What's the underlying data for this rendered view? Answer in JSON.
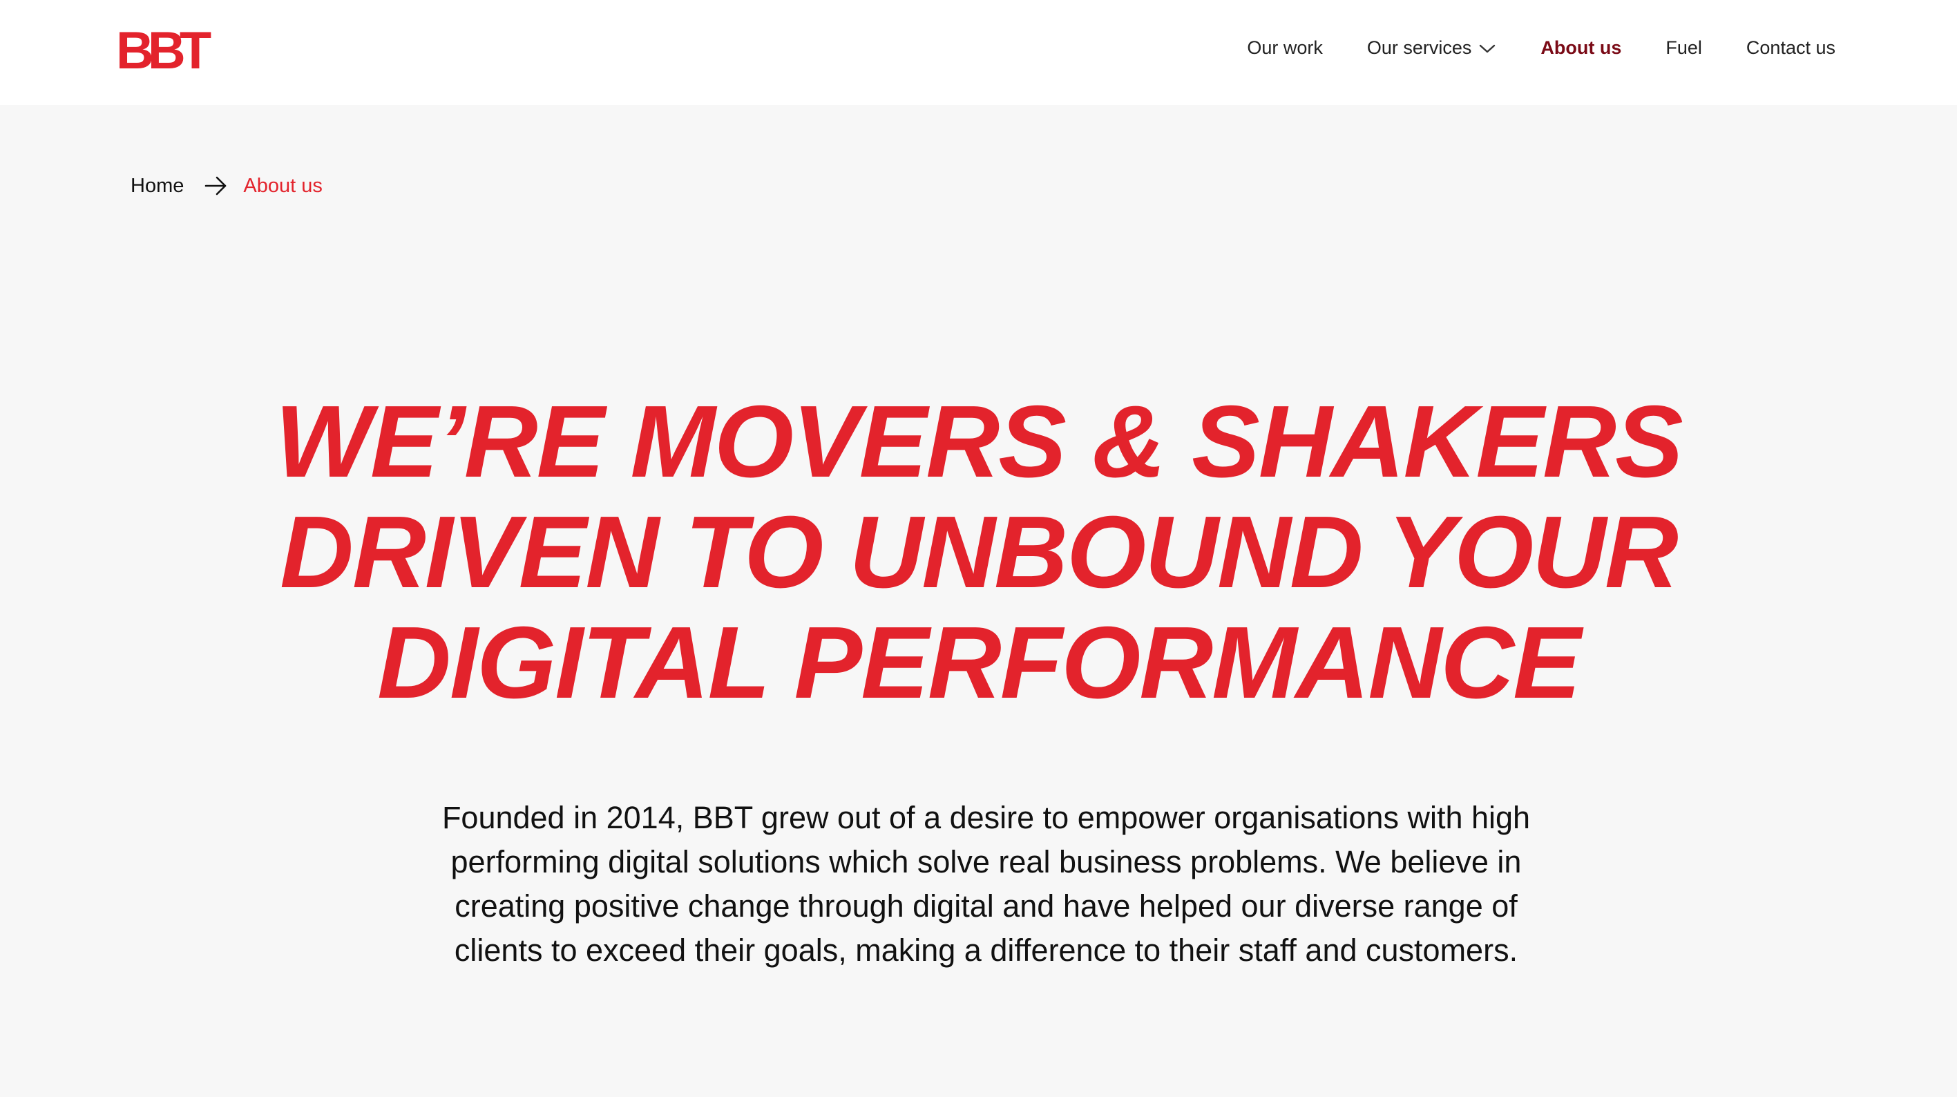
{
  "brand": {
    "logo_text": "BBT",
    "accent_color": "#e3232c",
    "active_nav_color": "#7a0a16"
  },
  "nav": {
    "items": [
      {
        "label": "Our work"
      },
      {
        "label": "Our services",
        "icon": "chevron-down-icon"
      },
      {
        "label": "About us",
        "active": true
      },
      {
        "label": "Fuel"
      },
      {
        "label": "Contact us"
      }
    ]
  },
  "breadcrumb": {
    "home": "Home",
    "separator_icon": "arrow-right-icon",
    "current": "About us"
  },
  "hero": {
    "lines": [
      "WE’RE MOVERS & SHAKERS",
      "DRIVEN TO UNBOUND YOUR",
      "DIGITAL PERFORMANCE"
    ],
    "intro": "Founded in 2014, BBT grew out of a desire to empower organisations with high performing digital solutions which solve real business problems. We believe in creating positive change through digital and have helped our diverse range of clients to exceed their goals, making a difference to their staff and customers."
  }
}
